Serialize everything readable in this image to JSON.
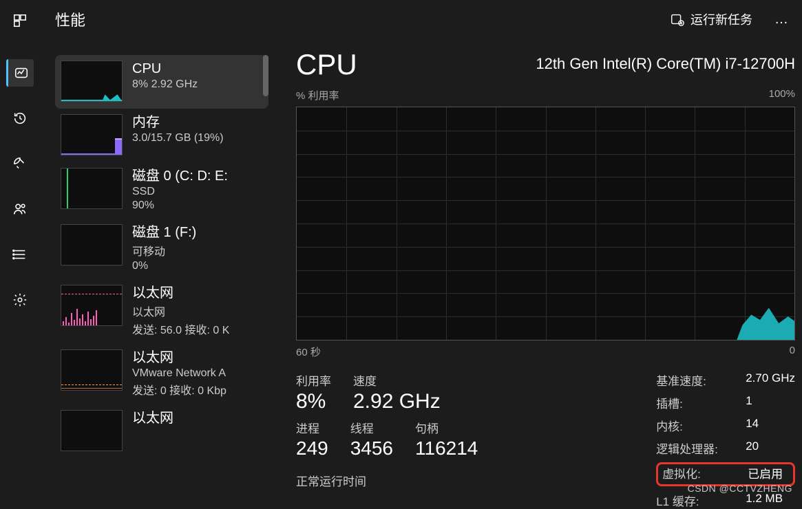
{
  "header": {
    "title": "性能",
    "run_new_task": "运行新任务",
    "more": "…"
  },
  "rail_icons": [
    "processes-icon",
    "performance-icon",
    "history-icon",
    "startup-icon",
    "users-icon",
    "details-icon",
    "settings-icon"
  ],
  "sidebar": [
    {
      "title": "CPU",
      "line2": "8% 2.92 GHz",
      "line3": ""
    },
    {
      "title": "内存",
      "line2": "3.0/15.7 GB (19%)",
      "line3": ""
    },
    {
      "title": "磁盘 0 (C: D: E:",
      "line2": "SSD",
      "line3": "90%"
    },
    {
      "title": "磁盘 1 (F:)",
      "line2": "可移动",
      "line3": "0%"
    },
    {
      "title": "以太网",
      "line2": "以太网",
      "line3": "发送: 56.0 接收: 0 K"
    },
    {
      "title": "以太网",
      "line2": "VMware Network A",
      "line3": "发送: 0 接收: 0 Kbp"
    },
    {
      "title": "以太网",
      "line2": "",
      "line3": ""
    }
  ],
  "main": {
    "title": "CPU",
    "model": "12th Gen Intel(R) Core(TM) i7-12700H",
    "chart_top_left": "% 利用率",
    "chart_top_right": "100%",
    "chart_bot_left": "60 秒",
    "chart_bot_right": "0",
    "metrics": {
      "util_lbl": "利用率",
      "util_val": "8%",
      "speed_lbl": "速度",
      "speed_val": "2.92 GHz",
      "proc_lbl": "进程",
      "proc_val": "249",
      "thread_lbl": "线程",
      "thread_val": "3456",
      "handle_lbl": "句柄",
      "handle_val": "116214"
    },
    "right": {
      "base_k": "基准速度:",
      "base_v": "2.70 GHz",
      "sockets_k": "插槽:",
      "sockets_v": "1",
      "cores_k": "内核:",
      "cores_v": "14",
      "lp_k": "逻辑处理器:",
      "lp_v": "20",
      "virt_k": "虚拟化:",
      "virt_v": "已启用",
      "l1_k": "L1 缓存:",
      "l1_v": "1.2 MB"
    },
    "uptime_lbl": "正常运行时间"
  },
  "watermark": "CSDN @CCTVZHENG",
  "chart_data": {
    "type": "line",
    "title": "% 利用率",
    "xlabel": "60 秒",
    "ylabel": "%",
    "ylim": [
      0,
      100
    ],
    "xlim": [
      60,
      0
    ],
    "series": [
      {
        "name": "CPU",
        "values_description": "flat near 0% across history, rising spike to ~12% at right edge"
      }
    ]
  }
}
